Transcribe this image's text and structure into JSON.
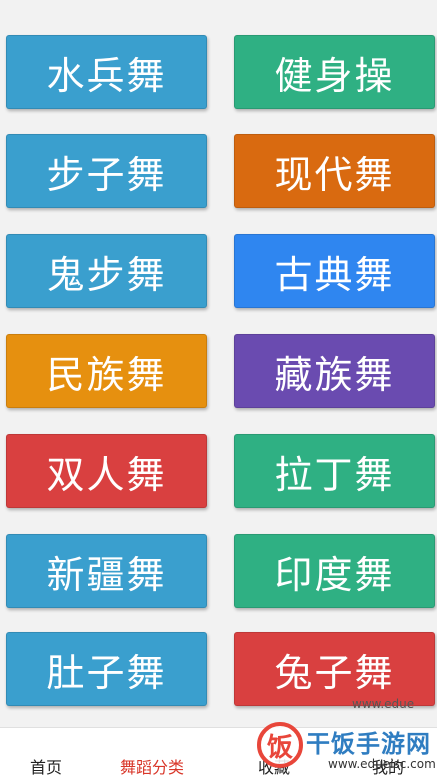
{
  "categories": [
    {
      "label": "水兵舞",
      "color": "#3a9fce"
    },
    {
      "label": "健身操",
      "color": "#2fb083"
    },
    {
      "label": "步子舞",
      "color": "#3a9fce"
    },
    {
      "label": "现代舞",
      "color": "#d96a10"
    },
    {
      "label": "鬼步舞",
      "color": "#3a9fce"
    },
    {
      "label": "古典舞",
      "color": "#2f86f0"
    },
    {
      "label": "民族舞",
      "color": "#e6900f"
    },
    {
      "label": "藏族舞",
      "color": "#6a4bb0"
    },
    {
      "label": "双人舞",
      "color": "#d94040"
    },
    {
      "label": "拉丁舞",
      "color": "#2fb083"
    },
    {
      "label": "新疆舞",
      "color": "#3a9fce"
    },
    {
      "label": "印度舞",
      "color": "#2fb083"
    },
    {
      "label": "肚子舞",
      "color": "#3a9fce"
    },
    {
      "label": "兔子舞",
      "color": "#d94040"
    }
  ],
  "tabbar": {
    "home": "首页",
    "dance_categories": "舞蹈分类",
    "favorites": "收藏",
    "mine": "我的",
    "active_color": "#d9372a"
  },
  "watermark": {
    "logo_char": "饭",
    "title": "干饭手游网",
    "url": "www.edueisc.com",
    "url_partial": "www.edue"
  }
}
